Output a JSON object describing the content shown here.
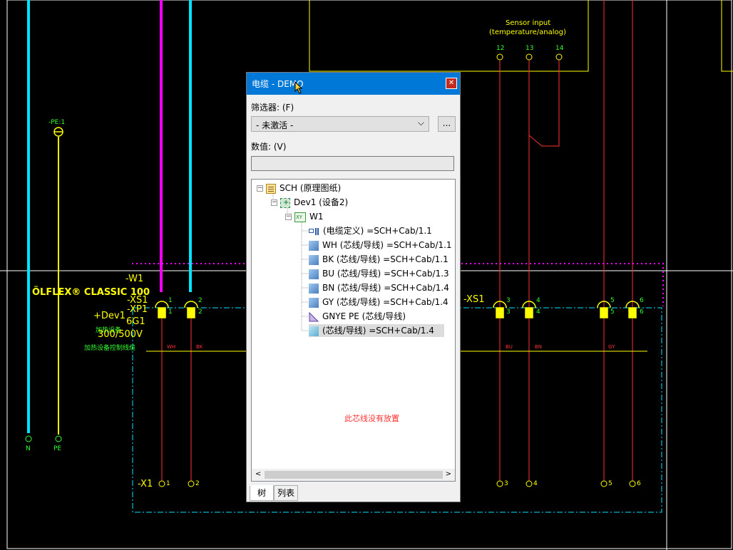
{
  "schematic": {
    "sensor_title": "Sensor input",
    "sensor_subtitle": "(temperature/analog)",
    "sensor_pins": [
      "12",
      "13",
      "14"
    ],
    "pe_tag": "-PE:1",
    "cable_tag": "-W1",
    "cable_type": "ÖLFLEX® CLASSIC 100",
    "xs1_left": "-XS1",
    "xp1": "-XP1",
    "dev_tag": "+Dev1",
    "cores": "6G1",
    "dev_name": "加热设备",
    "voltage": "300/500V",
    "cable_desc": "加热设备控制线缆",
    "xs1_right": "-XS1",
    "bottom_n": "N",
    "bottom_pe": "PE",
    "x1_tag": "-X1",
    "terminals": [
      "1",
      "2",
      "3",
      "4",
      "5",
      "6"
    ],
    "wire_colors": [
      "WH",
      "BK",
      "BU",
      "BN",
      "GY"
    ],
    "annotation": "此芯线没有放置",
    "colors": {
      "cyan": "#00e5ff",
      "magenta": "#ff00ff",
      "yellow": "#ffff00",
      "red": "#ff3333",
      "green": "#33ff33",
      "white": "#ffffff"
    }
  },
  "panel": {
    "title": "电缆 - DEMO",
    "close_icon": "close-icon",
    "filter_label": "筛选器: (F)",
    "filter_value": "- 未激活 -",
    "filter_more": "...",
    "value_label": "数值: (V)",
    "value_input": "",
    "tree": [
      {
        "label": "SCH (原理图纸)",
        "icon": "schematic-icon",
        "level": 0,
        "expander": "−"
      },
      {
        "label": "Dev1 (设备2)",
        "icon": "device-icon",
        "level": 1,
        "expander": "−"
      },
      {
        "label": "W1",
        "icon": "xy-cable-icon",
        "level": 2,
        "expander": "−"
      },
      {
        "label": "(电缆定义) =SCH+Cab/1.1",
        "icon": "cable-definition-icon",
        "level": 3
      },
      {
        "label": "WH (芯线/导线) =SCH+Cab/1.1",
        "icon": "wire-icon",
        "level": 3
      },
      {
        "label": "BK (芯线/导线) =SCH+Cab/1.1",
        "icon": "wire-icon",
        "level": 3
      },
      {
        "label": "BU (芯线/导线) =SCH+Cab/1.3",
        "icon": "wire-icon",
        "level": 3
      },
      {
        "label": "BN (芯线/导线) =SCH+Cab/1.4",
        "icon": "wire-icon",
        "level": 3
      },
      {
        "label": "GY (芯线/导线) =SCH+Cab/1.4",
        "icon": "wire-icon",
        "level": 3
      },
      {
        "label": "GNYE PE (芯线/导线)",
        "icon": "pe-wire-icon",
        "level": 3
      },
      {
        "label": "(芯线/导线) =SCH+Cab/1.4",
        "icon": "unplaced-wire-icon",
        "level": 3,
        "selected": true
      }
    ],
    "tabs": [
      "树",
      "列表"
    ]
  }
}
